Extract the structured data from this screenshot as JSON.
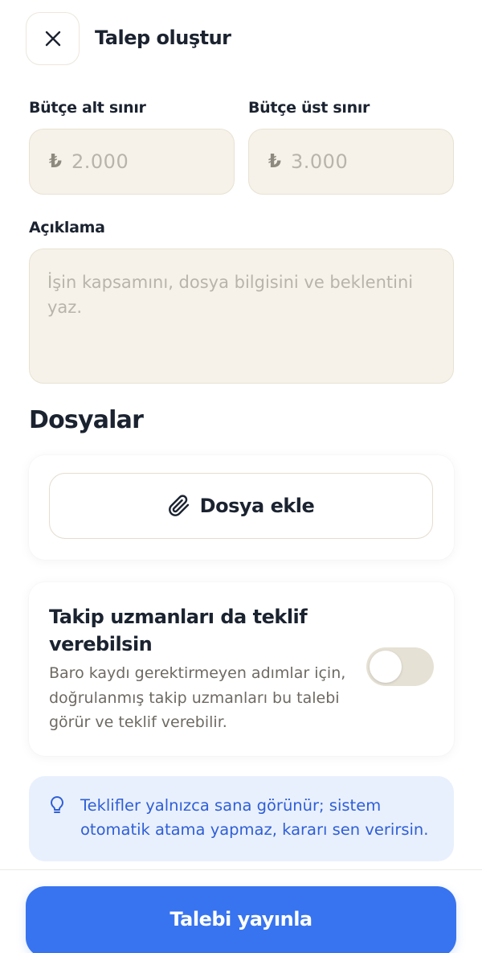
{
  "header": {
    "close_icon": "close-icon",
    "title": "Talep oluştur"
  },
  "budget": {
    "min_label": "Bütçe alt sınır",
    "max_label": "Bütçe üst sınır",
    "currency_symbol": "₺",
    "min_placeholder": "2.000",
    "max_placeholder": "3.000"
  },
  "description": {
    "label": "Açıklama",
    "placeholder": "İşin kapsamını, dosya bilgisini ve beklentini yaz."
  },
  "files": {
    "section_title": "Dosyalar",
    "add_icon": "paperclip-icon",
    "add_label": "Dosya ekle"
  },
  "follow_up": {
    "title": "Takip uzmanları da teklif verebilsin",
    "description": "Baro kaydı gerektirmeyen adımlar için, doğrulanmış takip uzmanları bu talebi görür ve teklif verebilir.",
    "enabled": false
  },
  "info": {
    "icon": "lightbulb-icon",
    "text": "Teklifler yalnızca sana görünür; sistem otomatik atama yapmaz, kararı sen verirsin."
  },
  "footer": {
    "publish_label": "Talebi yayınla"
  },
  "colors": {
    "primary": "#3874ef",
    "info_bg": "#e9f0fd",
    "input_bg": "#f6f2e9"
  }
}
